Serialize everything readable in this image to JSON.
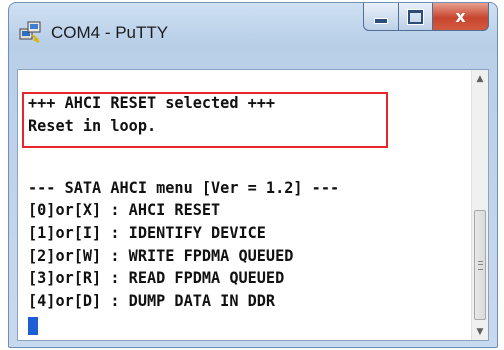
{
  "window": {
    "title": "COM4 - PuTTY",
    "caption_buttons": {
      "close_glyph": "x"
    }
  },
  "terminal": {
    "lines": [
      "+++ AHCI RESET selected +++",
      "Reset in loop.",
      "",
      "--- SATA AHCI menu [Ver = 1.2] ---",
      "[0]or[X] : AHCI RESET",
      "[1]or[I] : IDENTIFY DEVICE",
      "[2]or[W] : WRITE FPDMA QUEUED",
      "[3]or[R] : READ FPDMA QUEUED",
      "[4]or[D] : DUMP DATA IN DDR"
    ],
    "cursor_color": "#1f5fd6",
    "highlight_color": "#e5262d"
  },
  "scrollbar": {
    "up_glyph": "▲",
    "down_glyph": "▼"
  }
}
